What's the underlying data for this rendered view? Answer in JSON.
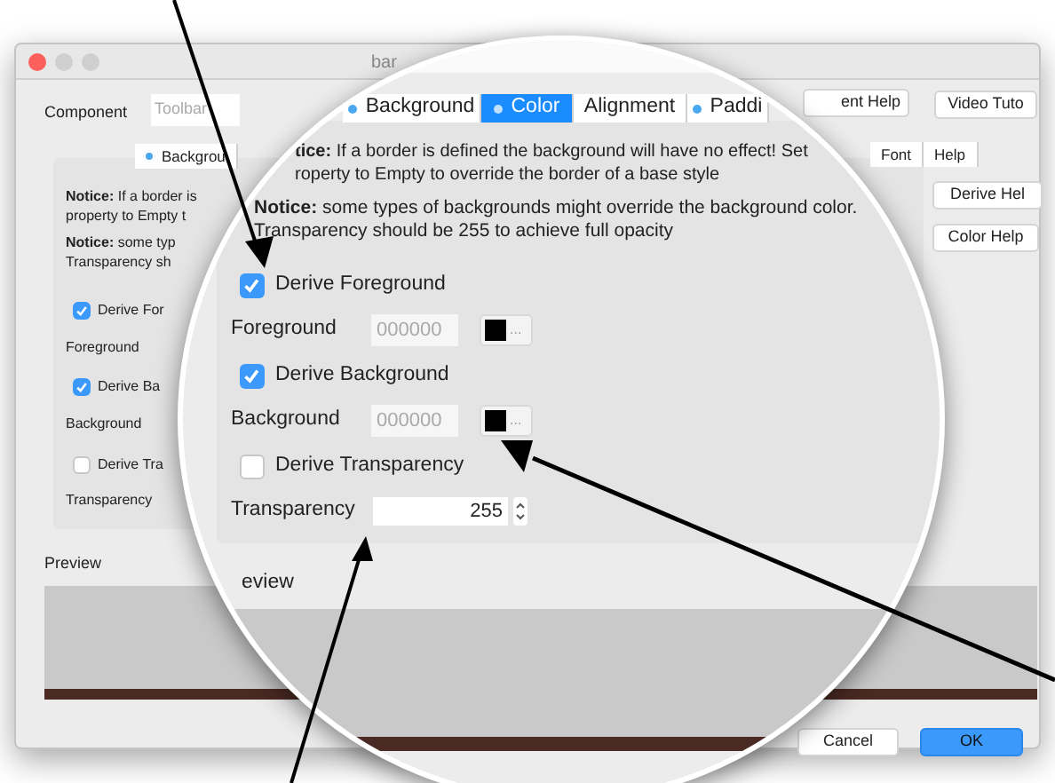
{
  "window": {
    "title": "bar"
  },
  "component": {
    "label": "Component",
    "value": "Toolbar"
  },
  "top_buttons": [
    "ent Help",
    "Video Tuto"
  ],
  "tabs": [
    {
      "label": "Backgrou",
      "dot": true,
      "selected": false
    },
    {
      "label": "Font",
      "dot": false,
      "selected": false
    },
    {
      "label": "Help",
      "dot": false,
      "selected": false
    }
  ],
  "notices": [
    {
      "lines": [
        "**Notice:** If a border is",
        "property to Empty t"
      ]
    },
    {
      "lines": [
        "**Notice:** some typ",
        "Transparency sh"
      ]
    }
  ],
  "rows": [
    {
      "kind": "checkbox",
      "label": "Derive For",
      "checked": true
    },
    {
      "kind": "label",
      "label": "Foreground"
    },
    {
      "kind": "checkbox",
      "label": "Derive Ba",
      "checked": true
    },
    {
      "kind": "label",
      "label": "Background"
    },
    {
      "kind": "checkbox",
      "label": "Derive Tra",
      "checked": false
    },
    {
      "kind": "label",
      "label": "Transparency"
    }
  ],
  "side_buttons": [
    "Derive Hel",
    "Color Help"
  ],
  "preview": {
    "label": "Preview"
  },
  "dialog_buttons": [
    {
      "label": "Cancel",
      "primary": false
    },
    {
      "label": "OK",
      "primary": true
    }
  ],
  "magnifier": {
    "tabs": [
      {
        "label": "Background",
        "dot": true,
        "selected": false
      },
      {
        "label": "Color",
        "dot": true,
        "selected": true
      },
      {
        "label": "Alignment",
        "dot": false,
        "selected": false
      },
      {
        "label": "Paddi",
        "dot": true,
        "selected": false
      }
    ],
    "notices": [
      {
        "lines": [
          "**tice:** If a border is defined the background will have no effect! Set",
          "roperty to Empty to override the border of a base style"
        ]
      },
      {
        "lines": [
          "**Notice:** some types of backgrounds might override the background color.",
          "Transparency should be 255 to achieve full opacity"
        ]
      }
    ],
    "rows": [
      {
        "kind": "checkbox",
        "label": "Derive Foreground",
        "checked": true
      },
      {
        "kind": "color",
        "label": "Foreground",
        "placeholder": "000000",
        "color": "#000000",
        "button_text": "..."
      },
      {
        "kind": "checkbox",
        "label": "Derive Background",
        "checked": true
      },
      {
        "kind": "color",
        "label": "Background",
        "placeholder": "000000",
        "color": "#000000",
        "button_text": "..."
      },
      {
        "kind": "checkbox",
        "label": "Derive Transparency",
        "checked": false
      },
      {
        "kind": "spinner",
        "label": "Transparency",
        "value": "255"
      }
    ],
    "preview_label": "eview"
  }
}
